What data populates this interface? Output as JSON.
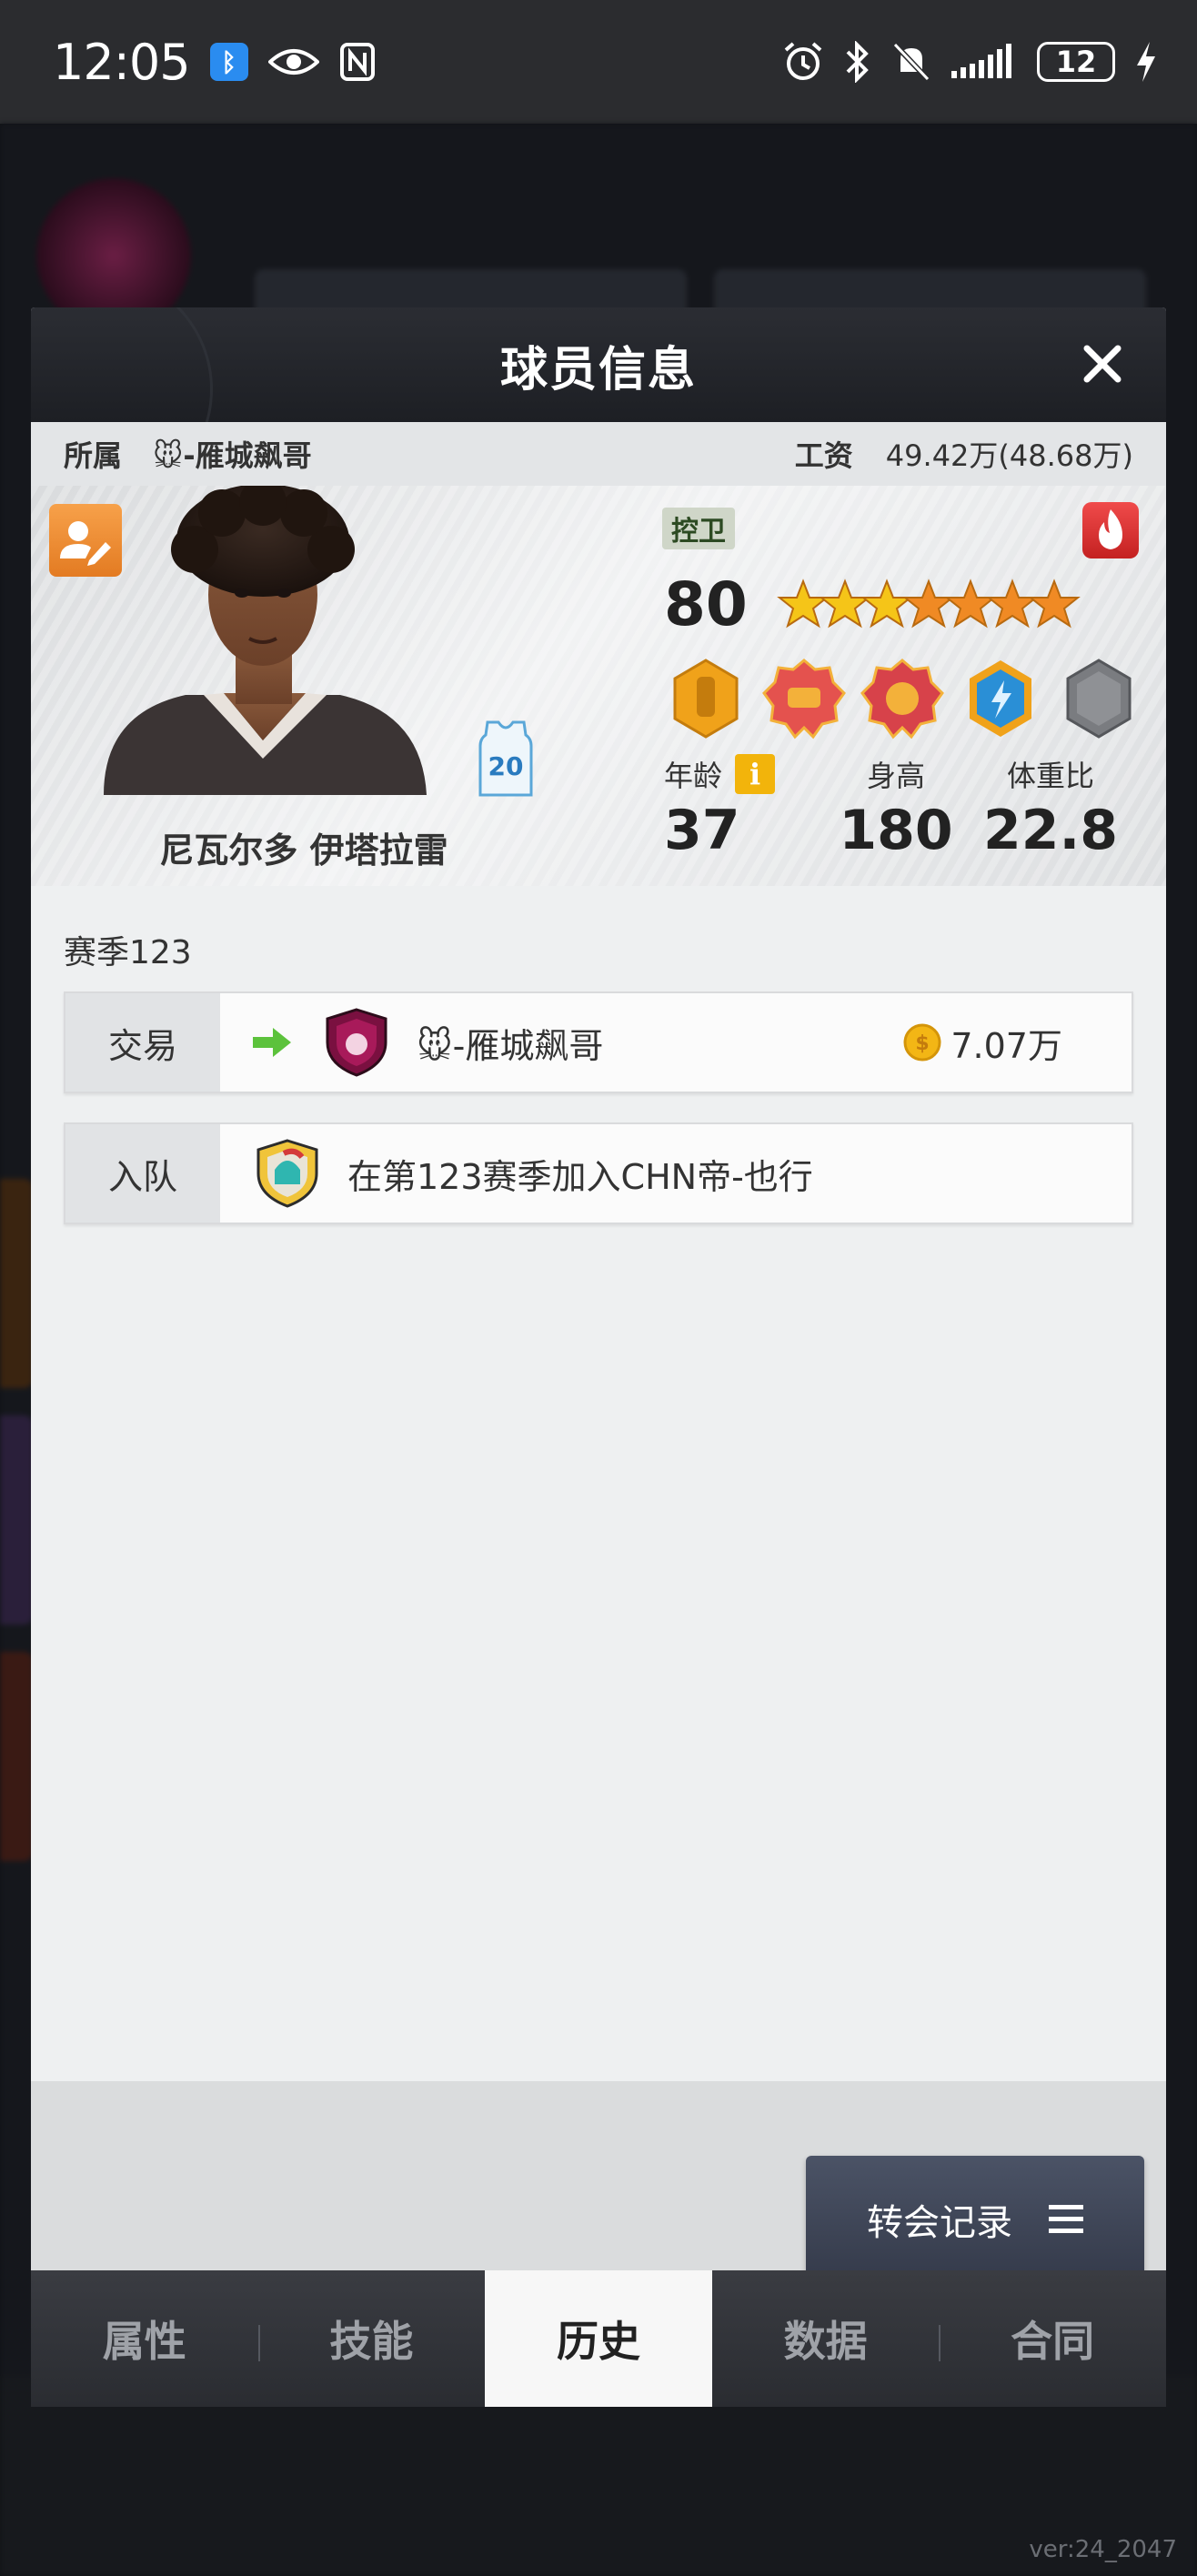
{
  "status_bar": {
    "time": "12:05",
    "battery": "12",
    "icons": [
      "bluetooth-app-icon",
      "eye-icon",
      "nfc-icon",
      "alarm-icon",
      "bluetooth-icon",
      "mute-icon",
      "signal-icon",
      "battery-icon",
      "charging-icon"
    ]
  },
  "modal": {
    "title": "球员信息",
    "team_label": "所属",
    "team_name": "🐭-雁城飙哥",
    "salary_label": "工资",
    "salary_value": "49.42万(48.68万)"
  },
  "player": {
    "name": "尼瓦尔多 伊塔拉雷",
    "jersey_number": "20",
    "position": "控卫",
    "rating": "80",
    "stars_total": 7,
    "stars_gold": 3,
    "attributes": {
      "age_label": "年龄",
      "age": "37",
      "height_label": "身高",
      "height": "180",
      "weight_ratio_label": "体重比",
      "weight_ratio": "22.8"
    },
    "info_icon": "i"
  },
  "history": {
    "season_label": "赛季123",
    "rows": [
      {
        "type": "交易",
        "team": "🐭-雁城飙哥",
        "amount": "7.07万"
      },
      {
        "type": "入队",
        "text": "在第123赛季加入CHN帝-也行"
      }
    ]
  },
  "transfer_button": {
    "label": "转会记录"
  },
  "tabs": [
    {
      "label": "属性"
    },
    {
      "label": "技能"
    },
    {
      "label": "历史"
    },
    {
      "label": "数据"
    },
    {
      "label": "合同"
    }
  ],
  "version": "ver:24_2047",
  "colors": {
    "header_dark": "#1d1f24",
    "accent_orange": "#e37b22",
    "accent_red": "#c42121",
    "star_gold": "#f5c518",
    "star_orange": "#f08a24",
    "button_dark": "#343a4a"
  }
}
